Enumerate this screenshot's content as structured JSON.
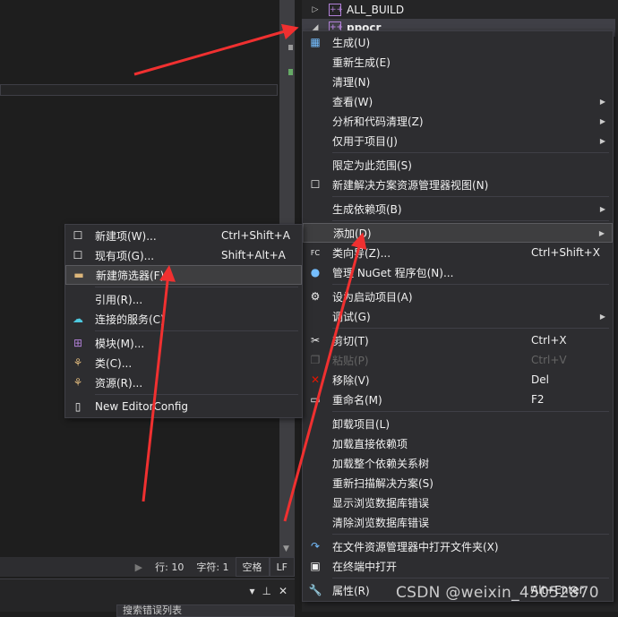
{
  "tree": {
    "rows": [
      {
        "label": "ALL_BUILD"
      },
      {
        "label": "ppocr"
      }
    ]
  },
  "status": {
    "line": "行: 10",
    "char": "字符: 1",
    "space": "空格",
    "eol": "LF"
  },
  "error_panel": {
    "search_placeholder": "搜索错误列表"
  },
  "context_menu": {
    "items": [
      {
        "label": "生成(U)",
        "icon": "build-icon",
        "glyph": "▦",
        "color": "#75beff"
      },
      {
        "label": "重新生成(E)"
      },
      {
        "label": "清理(N)"
      },
      {
        "label": "查看(W)",
        "submenu": true
      },
      {
        "label": "分析和代码清理(Z)",
        "submenu": true
      },
      {
        "label": "仅用于项目(J)",
        "submenu": true
      },
      {
        "sep": true
      },
      {
        "label": "限定为此范围(S)"
      },
      {
        "label": "新建解决方案资源管理器视图(N)",
        "icon": "new-view-icon",
        "glyph": "☐"
      },
      {
        "sep": true
      },
      {
        "label": "生成依赖项(B)",
        "submenu": true
      },
      {
        "sep": true
      },
      {
        "label": "添加(D)",
        "submenu": true,
        "highlighted": true
      },
      {
        "label": "类向导(Z)...",
        "shortcut": "Ctrl+Shift+X",
        "icon": "class-wizard-icon",
        "glyph": "FC"
      },
      {
        "label": "管理 NuGet 程序包(N)...",
        "icon": "nuget-icon",
        "glyph": "●",
        "color": "#75beff"
      },
      {
        "sep": true
      },
      {
        "label": "设为启动项目(A)",
        "icon": "gear-icon",
        "glyph": "⚙"
      },
      {
        "label": "调试(G)",
        "submenu": true
      },
      {
        "sep": true
      },
      {
        "label": "剪切(T)",
        "shortcut": "Ctrl+X",
        "icon": "cut-icon",
        "glyph": "✂"
      },
      {
        "label": "粘贴(P)",
        "shortcut": "Ctrl+V",
        "disabled": true,
        "icon": "paste-icon",
        "glyph": "❐"
      },
      {
        "label": "移除(V)",
        "shortcut": "Del",
        "icon": "remove-icon",
        "glyph": "✕",
        "color": "#e51400"
      },
      {
        "label": "重命名(M)",
        "shortcut": "F2",
        "icon": "rename-icon",
        "glyph": "▭"
      },
      {
        "sep": true
      },
      {
        "label": "卸载项目(L)"
      },
      {
        "label": "加载直接依赖项"
      },
      {
        "label": "加载整个依赖关系树"
      },
      {
        "label": "重新扫描解决方案(S)"
      },
      {
        "label": "显示浏览数据库错误"
      },
      {
        "label": "清除浏览数据库错误"
      },
      {
        "sep": true
      },
      {
        "label": "在文件资源管理器中打开文件夹(X)",
        "icon": "open-folder-icon",
        "glyph": "↷",
        "color": "#75beff"
      },
      {
        "label": "在终端中打开",
        "icon": "terminal-icon",
        "glyph": "▣"
      },
      {
        "sep": true
      },
      {
        "label": "属性(R)",
        "shortcut": "Alt+Enter",
        "icon": "wrench-icon",
        "glyph": "🔧"
      }
    ]
  },
  "add_submenu": {
    "items": [
      {
        "label": "新建项(W)...",
        "shortcut": "Ctrl+Shift+A",
        "icon": "new-item-icon",
        "glyph": "☐"
      },
      {
        "label": "现有项(G)...",
        "shortcut": "Shift+Alt+A",
        "icon": "existing-item-icon",
        "glyph": "☐"
      },
      {
        "label": "新建筛选器(F)",
        "highlighted": true,
        "icon": "new-filter-folder-icon",
        "glyph": "▬",
        "color": "#dcb67a"
      },
      {
        "sep": true
      },
      {
        "label": "引用(R)..."
      },
      {
        "label": "连接的服务(C)",
        "icon": "connected-service-icon",
        "glyph": "☁",
        "color": "#4ec9e0"
      },
      {
        "sep": true
      },
      {
        "label": "模块(M)...",
        "icon": "module-icon",
        "glyph": "⊞",
        "color": "#b180d7"
      },
      {
        "label": "类(C)...",
        "icon": "class-icon",
        "glyph": "⚘",
        "color": "#dcb67a"
      },
      {
        "label": "资源(R)...",
        "icon": "resource-icon",
        "glyph": "⚘",
        "color": "#dcb67a"
      },
      {
        "sep": true
      },
      {
        "label": "New EditorConfig",
        "icon": "file-icon",
        "glyph": "▯"
      }
    ]
  },
  "watermark": "CSDN @weixin_45052870"
}
